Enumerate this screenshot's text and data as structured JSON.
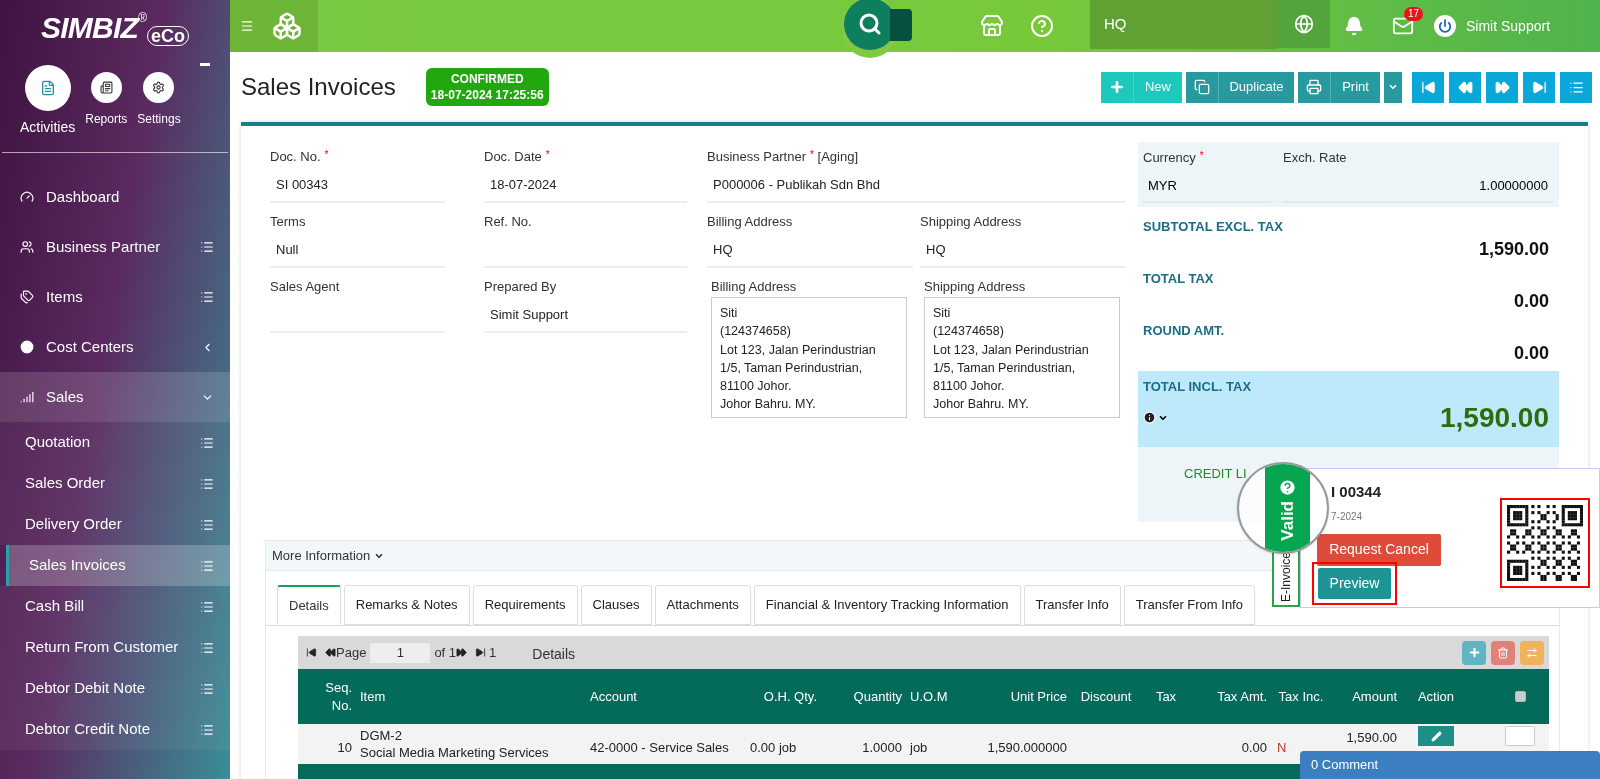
{
  "sidebar": {
    "logo": "SIMBIZ",
    "logo_mark": "®",
    "logo_sub": "eCo",
    "modules": [
      {
        "label": "Activities",
        "selected": true
      },
      {
        "label": "Reports",
        "selected": false
      },
      {
        "label": "Settings",
        "selected": false
      }
    ],
    "menu": [
      {
        "label": "Dashboard",
        "kind": "link"
      },
      {
        "label": "Business Partner",
        "kind": "list"
      },
      {
        "label": "Items",
        "kind": "list"
      },
      {
        "label": "Cost Centers",
        "kind": "group",
        "expanded": false
      },
      {
        "label": "Sales",
        "kind": "group",
        "expanded": true,
        "children": [
          {
            "label": "Quotation",
            "selected": false
          },
          {
            "label": "Sales Order",
            "selected": false
          },
          {
            "label": "Delivery Order",
            "selected": false
          },
          {
            "label": "Sales Invoices",
            "selected": true
          },
          {
            "label": "Cash Bill",
            "selected": false
          },
          {
            "label": "Return From Customer",
            "selected": false
          },
          {
            "label": "Debtor Debit Note",
            "selected": false
          },
          {
            "label": "Debtor Credit Note",
            "selected": false
          }
        ]
      }
    ]
  },
  "topbar": {
    "location": "HQ",
    "mail_count": "17",
    "user": "Simit Support"
  },
  "header": {
    "title": "Sales Invoices",
    "status": {
      "label": "CONFIRMED",
      "timestamp": "18-07-2024 17:25:56"
    },
    "buttons": [
      {
        "label": "New",
        "kind": "new"
      },
      {
        "label": "Duplicate",
        "kind": "duplicate"
      },
      {
        "label": "Print",
        "kind": "print"
      }
    ]
  },
  "form": {
    "left": [
      {
        "label": "Doc. No.",
        "required_mark": "*",
        "value": "SI 00343"
      },
      {
        "label": "Doc. Date",
        "required_mark": "*",
        "value": "18-07-2024"
      },
      {
        "label": "Terms",
        "value": "Null"
      },
      {
        "label": "Ref. No."
      },
      {
        "label": "Sales Agent"
      },
      {
        "label": "Prepared By",
        "value": "Simit Support"
      }
    ],
    "partner": {
      "label": "Business Partner",
      "required_mark": "*",
      "suffix": "[Aging]",
      "value": "P000006 - Publikah Sdn Bhd"
    },
    "addresses": [
      {
        "label": "Billing Address",
        "value": "HQ"
      },
      {
        "label": "Shipping Address",
        "value": "HQ"
      }
    ],
    "address_boxes": [
      {
        "label": "Billing Address",
        "lines": [
          "Siti",
          "(124374658)",
          "Lot 123, Jalan Perindustrian",
          "1/5, Taman Perindustrian,",
          "81100 Johor.",
          "Johor Bahru. MY."
        ]
      },
      {
        "label": "Shipping Address",
        "lines": [
          "Siti",
          "(124374658)",
          "Lot 123, Jalan Perindustrian",
          "1/5, Taman Perindustrian,",
          "81100 Johor.",
          "Johor Bahru. MY."
        ]
      }
    ]
  },
  "summary": {
    "currency": {
      "label": "Currency",
      "required_mark": "*",
      "value": "MYR"
    },
    "exch_rate": {
      "label": "Exch. Rate",
      "value": "1.00000000"
    },
    "totals": [
      {
        "label": "SUBTOTAL EXCL. TAX",
        "value": "1,590.00"
      },
      {
        "label": "TOTAL TAX",
        "value": "0.00"
      },
      {
        "label": "ROUND AMT.",
        "value": "0.00"
      }
    ],
    "grand_total": {
      "label": "TOTAL INCL. TAX",
      "value": "1,590.00"
    },
    "credit_label": "CREDIT LI"
  },
  "einvoice": {
    "tab": "E-Invoice",
    "status": "Valid",
    "doc_no": "I 00344",
    "date": "7-2024",
    "buttons": [
      {
        "label": "Request Cancel",
        "kind": "danger"
      },
      {
        "label": "Preview",
        "kind": "primary"
      }
    ]
  },
  "more_info": "More Information",
  "tabs": [
    {
      "label": "Details",
      "selected": true
    },
    {
      "label": "Remarks & Notes",
      "selected": false
    },
    {
      "label": "Requirements",
      "selected": false
    },
    {
      "label": "Clauses",
      "selected": false
    },
    {
      "label": "Attachments",
      "selected": false
    },
    {
      "label": "Financial & Inventory Tracking Information",
      "selected": false
    },
    {
      "label": "Transfer Info",
      "selected": false
    },
    {
      "label": "Transfer From Info",
      "selected": false
    }
  ],
  "grid": {
    "pager": {
      "page_label": "Page",
      "page": "1",
      "of": "of 1",
      "count": "1"
    },
    "title": "Details",
    "select_all_checked": false,
    "columns": [
      "Seq. No.",
      "Item",
      "Account",
      "O.H. Qty.",
      "Quantity",
      "U.O.M",
      "Unit Price",
      "Discount",
      "Tax",
      "Tax Amt.",
      "Tax Inc.",
      "Amount",
      "Action"
    ],
    "rows": [
      {
        "seq": "10",
        "item": "DGM-2",
        "description": "Social Media Marketing Services",
        "account": "42-0000 - Service Sales",
        "oh_qty": "0.00 job",
        "quantity": "1.0000",
        "uom": "job",
        "unit_price": "1,590.000000",
        "tax_amt": "0.00",
        "tax_inc": "N",
        "amount": "1,590.00",
        "checked": false
      }
    ]
  },
  "comments": "0 Comment"
}
